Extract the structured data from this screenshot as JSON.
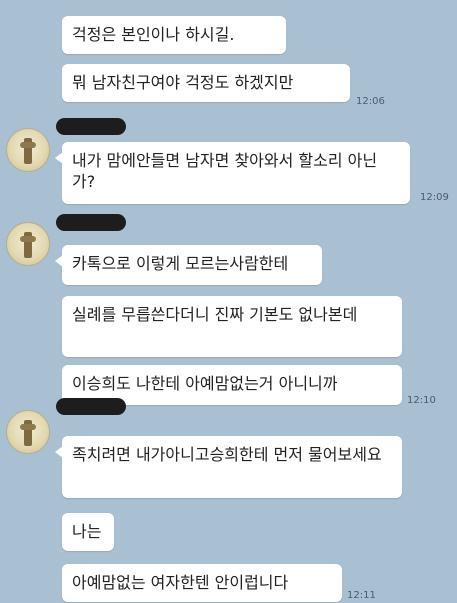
{
  "messages": {
    "m1": "걱정은 본인이나 하시길.",
    "m2": "뭐 남자친구여야 걱정도 하겠지만",
    "m3": "내가 맘에안들면 남자면 찾아와서 할소리 아닌가?",
    "m4": "카톡으로 이렇게 모르는사람한테",
    "m5": "실례를 무릅쓴다더니 진짜 기본도 없나본데",
    "m6": "이승희도 나한테 아예맘없는거 아니니까",
    "m7": "족치려면 내가아니고승희한테 먼저 물어보세요",
    "m8": "나는",
    "m9": "아예맘없는 여자한텐 안이럽니다"
  },
  "times": {
    "t1": "12:06",
    "t2": "12:09",
    "t3": "12:10",
    "t4": "12:11"
  }
}
